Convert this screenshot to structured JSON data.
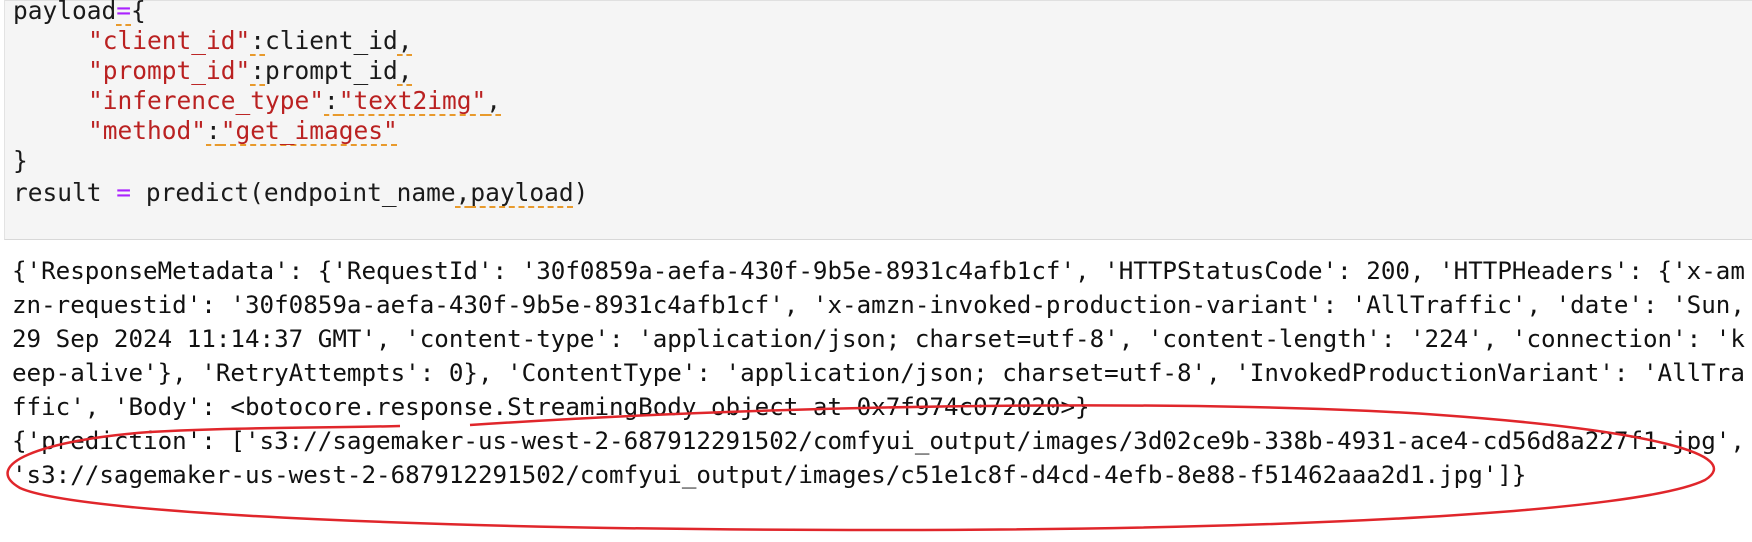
{
  "code": {
    "line1": {
      "var": "payload",
      "op": "=",
      "brace": "{"
    },
    "line2": {
      "key": "\"client_id\"",
      "colon": ":",
      "value": "client_id",
      "comma": ","
    },
    "line3": {
      "key": "\"prompt_id\"",
      "colon": ":",
      "value": "prompt_id",
      "comma": ","
    },
    "line4": {
      "key": "\"inference_type\"",
      "colon": ":",
      "value": "\"text2img\"",
      "comma": ","
    },
    "line5": {
      "key": "\"method\"",
      "colon": ":",
      "value": "\"get_images\""
    },
    "line6": {
      "brace": "}"
    },
    "line7": {
      "var": "result",
      "op": "=",
      "call": "predict(endpoint_name",
      "comma": ",",
      "arg": "payload",
      "close": ")"
    }
  },
  "output": {
    "metadata": "{'ResponseMetadata': {'RequestId': '30f0859a-aefa-430f-9b5e-8931c4afb1cf', 'HTTPStatusCode': 200, 'HTTPHeaders': {'x-amzn-requestid': '30f0859a-aefa-430f-9b5e-8931c4afb1cf', 'x-amzn-invoked-production-variant': 'AllTraffic', 'date': 'Sun, 29 Sep 2024 11:14:37 GMT', 'content-type': 'application/json; charset=utf-8', 'content-length': '224', 'connection': 'keep-alive'}, 'RetryAttempts': 0}, 'ContentType': 'application/json; charset=utf-8', 'InvokedProductionVariant': 'AllTraffic', 'Body': <botocore.response.StreamingBody object at 0x7f974c072020>}",
    "prediction": "{'prediction': ['s3://sagemaker-us-west-2-687912291502/comfyui_output/images/3d02ce9b-338b-4931-ace4-cd56d8a227f1.jpg', 's3://sagemaker-us-west-2-687912291502/comfyui_output/images/c51e1c8f-d4cd-4efb-8e88-f51462aaa2d1.jpg']}"
  },
  "colors": {
    "cell_background": "#f5f5f5",
    "string": "#ba2121",
    "operator": "#aa22ff",
    "lint_underline": "#e89a2c",
    "annotation": "#e0262b"
  }
}
